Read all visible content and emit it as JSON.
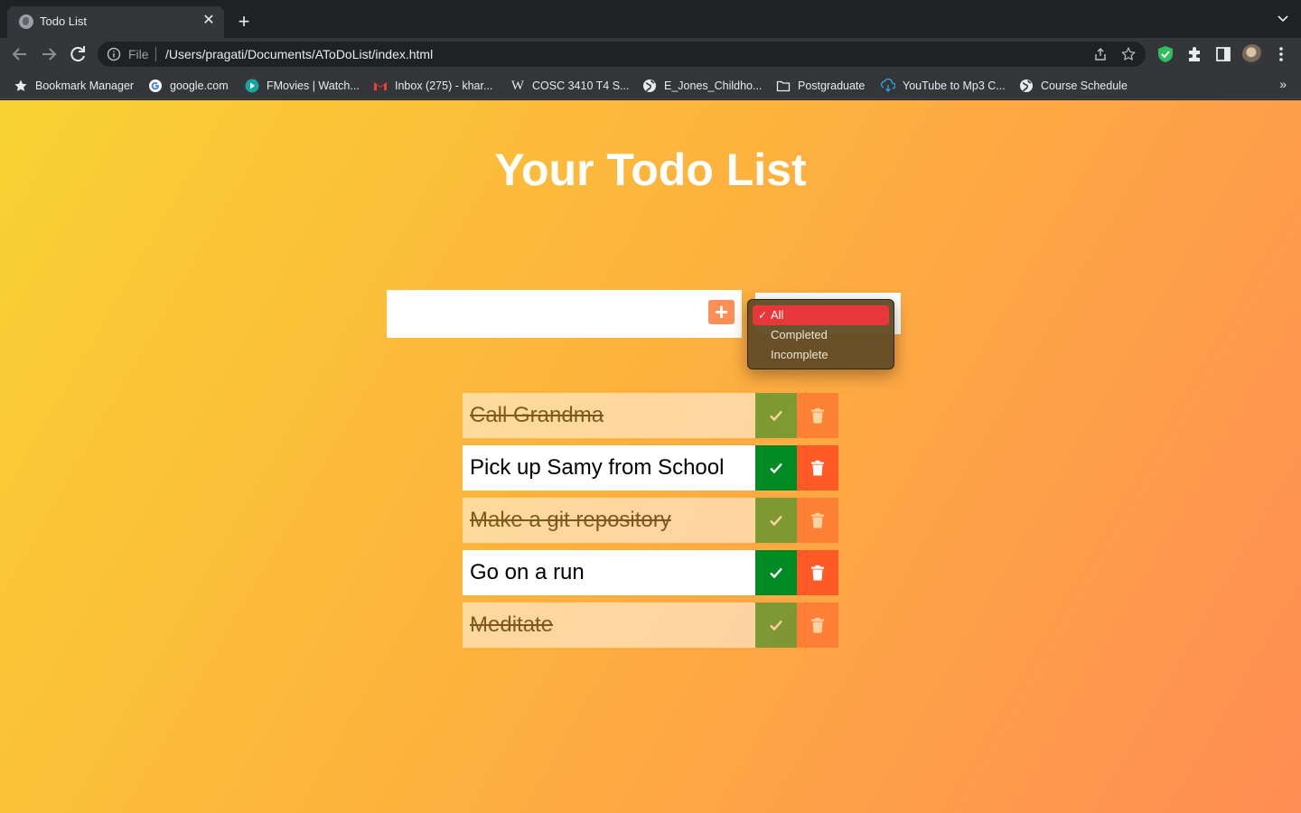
{
  "browser": {
    "tab_title": "Todo List",
    "address_scheme": "File",
    "address_url": "/Users/pragati/Documents/AToDoList/index.html",
    "bookmarks": [
      {
        "label": "Bookmark Manager",
        "icon": "star-icon"
      },
      {
        "label": "google.com",
        "icon": "google-icon"
      },
      {
        "label": "FMovies | Watch...",
        "icon": "play-icon"
      },
      {
        "label": "Inbox (275) - khar...",
        "icon": "gmail-icon"
      },
      {
        "label": "COSC 3410 T4 S...",
        "icon": "wikipedia-icon"
      },
      {
        "label": "E_Jones_Childho...",
        "icon": "globe-icon"
      },
      {
        "label": "Postgraduate",
        "icon": "folder-icon"
      },
      {
        "label": "YouTube to Mp3 C...",
        "icon": "download-icon"
      },
      {
        "label": "Course Schedule",
        "icon": "globe-icon"
      }
    ],
    "more_bookmarks": "»"
  },
  "app": {
    "title": "Your Todo List",
    "input_value": "",
    "add_button_icon": "plus-icon",
    "filter": {
      "selected": "All",
      "options": [
        "All",
        "Completed",
        "Incomplete"
      ]
    },
    "todos": [
      {
        "text": "Call Grandma",
        "completed": true
      },
      {
        "text": "Pick up Samy from School",
        "completed": false
      },
      {
        "text": "Make a git repository",
        "completed": true
      },
      {
        "text": "Go on a run",
        "completed": false
      },
      {
        "text": "Meditate",
        "completed": true
      }
    ]
  },
  "colors": {
    "gradient_start": "#f8d233",
    "gradient_end": "#ff8d54",
    "check_button": "#008a23",
    "trash_button": "#ff5a26",
    "add_button": "#ff8f57",
    "dropdown_highlight": "#e8373a"
  }
}
